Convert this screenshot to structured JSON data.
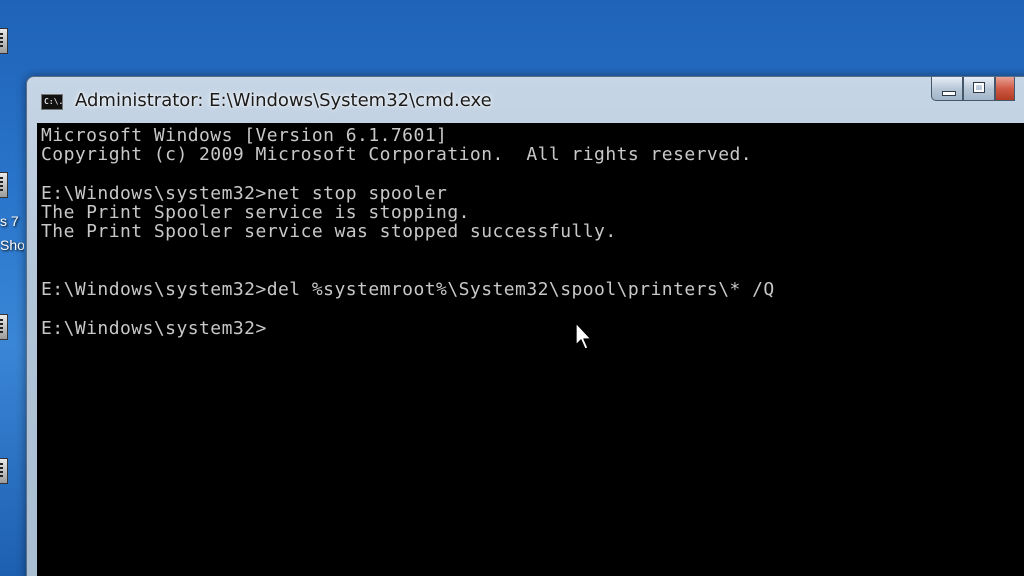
{
  "desktop": {
    "labels": [
      "s 7",
      "Sho"
    ]
  },
  "window": {
    "title": "Administrator: E:\\Windows\\System32\\cmd.exe",
    "icon_text": "C:\\.",
    "controls": [
      "minimize-icon",
      "maximize-icon",
      "close-icon"
    ]
  },
  "console": {
    "lines": [
      "Microsoft Windows [Version 6.1.7601]",
      "Copyright (c) 2009 Microsoft Corporation.  All rights reserved.",
      "",
      "E:\\Windows\\system32>net stop spooler",
      "The Print Spooler service is stopping.",
      "The Print Spooler service was stopped successfully.",
      "",
      "",
      "E:\\Windows\\system32>del %systemroot%\\System32\\spool\\printers\\* /Q",
      "",
      "E:\\Windows\\system32>"
    ]
  },
  "colors": {
    "console_background": "#000000",
    "console_text": "#c8c8c8",
    "desktop_blue": "#2a76cc"
  }
}
